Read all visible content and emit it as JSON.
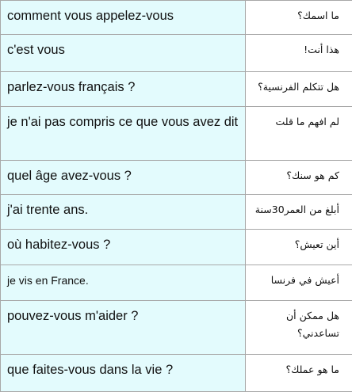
{
  "rows": [
    {
      "fr": "comment vous appelez-vous",
      "ar": "ما اسمك؟"
    },
    {
      "fr": "c'est vous",
      "ar": "هذا أنت!"
    },
    {
      "fr": "parlez-vous français ?",
      "ar": "هل تتكلم الفرنسية؟"
    },
    {
      "fr": "je n'ai pas compris ce que vous avez dit",
      "ar": "لم افهم ما قلت"
    },
    {
      "fr": "quel âge avez-vous ?",
      "ar": "كم هو سنك؟"
    },
    {
      "fr": "j'ai trente ans.",
      "ar": "أبلغ من العمر30سنة"
    },
    {
      "fr": "où habitez-vous ?",
      "ar": "أين تعيش؟"
    },
    {
      "fr": "je vis en France.",
      "ar": "أعيش في فرنسا"
    },
    {
      "fr": "pouvez-vous m'aider ?",
      "ar": "هل ممكن أن تساعدني؟"
    },
    {
      "fr": "que faites-vous dans la vie ?",
      "ar": "ما هو عملك؟"
    }
  ]
}
